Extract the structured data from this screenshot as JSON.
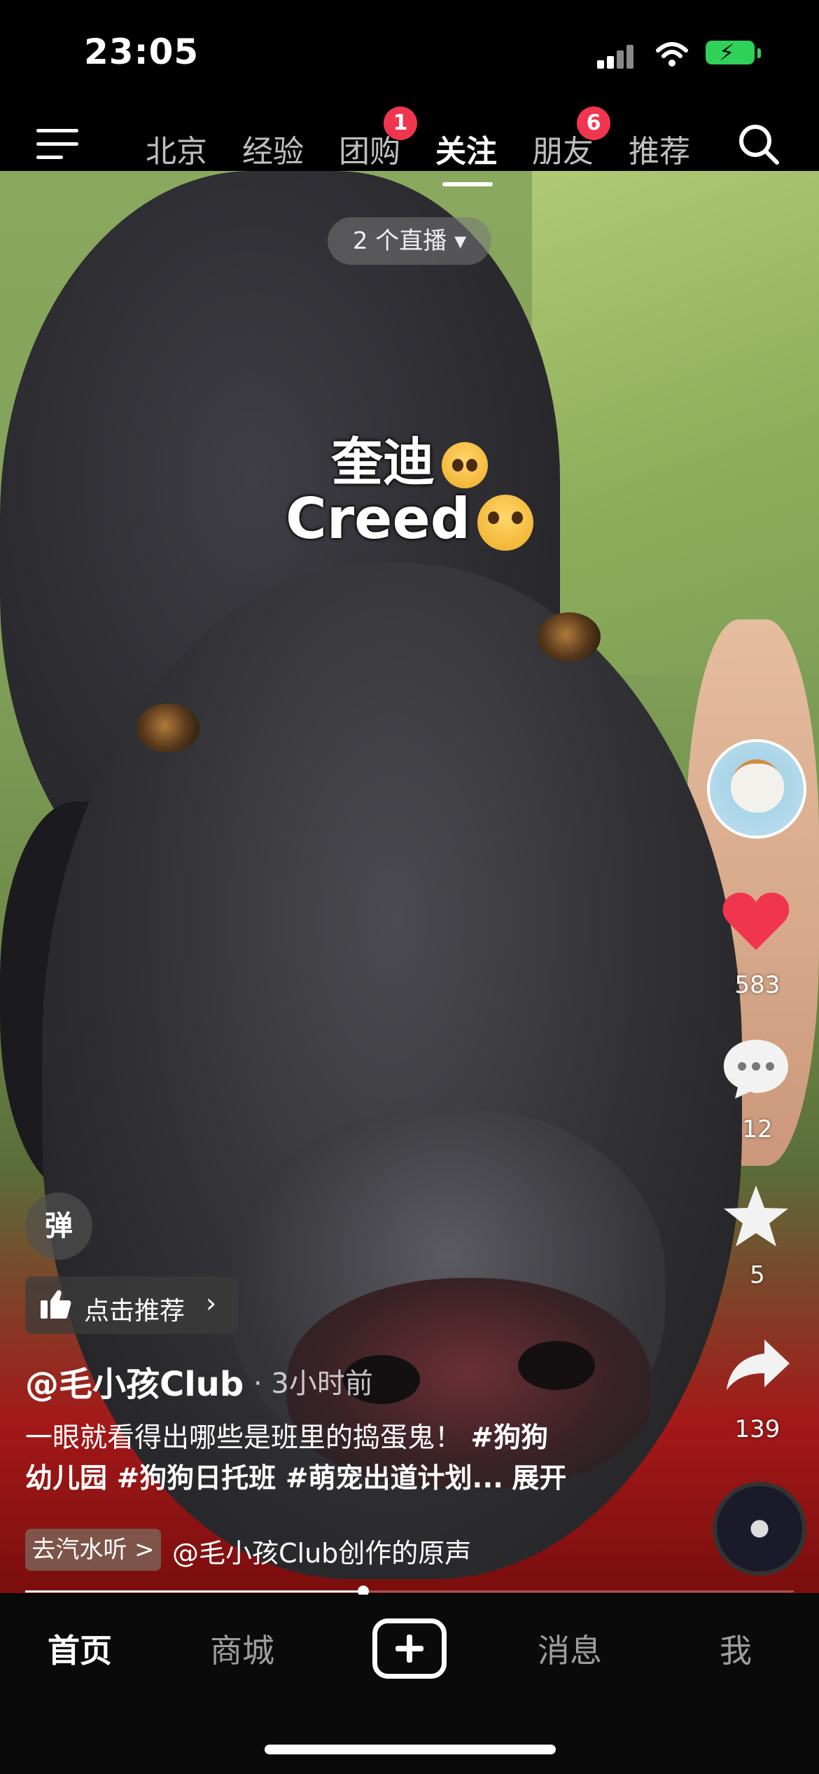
{
  "status_bar": {
    "time": "23:05"
  },
  "top_tabs": [
    {
      "label": "北京"
    },
    {
      "label": "经验"
    },
    {
      "label": "团购",
      "badge": "1"
    },
    {
      "label": "关注",
      "active": true
    },
    {
      "label": "朋友",
      "badge": "6"
    },
    {
      "label": "推荐"
    }
  ],
  "live_pill": "2 个直播 ▾",
  "video_caption": {
    "line1": "奎迪",
    "line2": "Creed"
  },
  "rail": {
    "likes": "583",
    "comments": "12",
    "favorites": "5",
    "shares": "139"
  },
  "danmu_label": "弹",
  "recommend_label": "点击推荐",
  "author": "@毛小孩Club",
  "time_ago": "· 3小时前",
  "description": {
    "line1": "一眼就看得出哪些是班里的捣蛋鬼！",
    "tag1": "#狗狗",
    "line2_tags": "幼儿园 #狗狗日托班 #萌宠出道计划...",
    "expand": "展开"
  },
  "music": {
    "chip": "去汽水听 >",
    "text": "@毛小孩Club创作的原声"
  },
  "playback_progress": 0.44,
  "bottom_nav": [
    {
      "label": "首页",
      "active": true
    },
    {
      "label": "商城"
    },
    {
      "label": "消息"
    },
    {
      "label": "我"
    }
  ],
  "colors": {
    "like_red": "#f0364f",
    "badge_red": "#f0364f",
    "battery_green": "#2fd158"
  }
}
